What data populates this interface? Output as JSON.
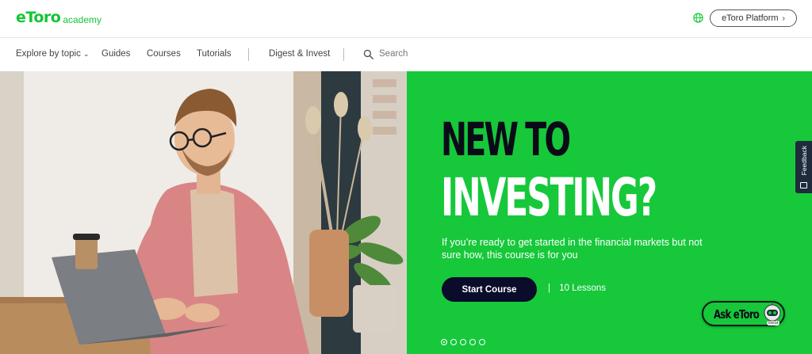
{
  "brand": {
    "logo_main": "eToro",
    "logo_sub": "academy",
    "accent_color": "#16c83a",
    "dark_color": "#0b0b2a"
  },
  "header": {
    "language_icon": "globe-icon",
    "platform_button": "eToro Platform",
    "platform_chevron": "›"
  },
  "nav": {
    "explore": "Explore by topic",
    "explore_chevron": "⌄",
    "guides": "Guides",
    "courses": "Courses",
    "tutorials": "Tutorials",
    "digest": "Digest & Invest",
    "search": "Search",
    "search_icon": "search-icon"
  },
  "hero": {
    "headline_line1": "NEW TO",
    "headline_line2": "INVESTING?",
    "subtitle": "If you’re ready to get started in the financial markets but not sure how, this course is for you",
    "cta": "Start Course",
    "separator": "|",
    "lessons": "10 Lessons",
    "carousel_total": 5,
    "carousel_active": 1
  },
  "feedback": {
    "label": "Feedback"
  },
  "ask_widget": {
    "label": "Ask eToro",
    "badge": "Beta"
  }
}
